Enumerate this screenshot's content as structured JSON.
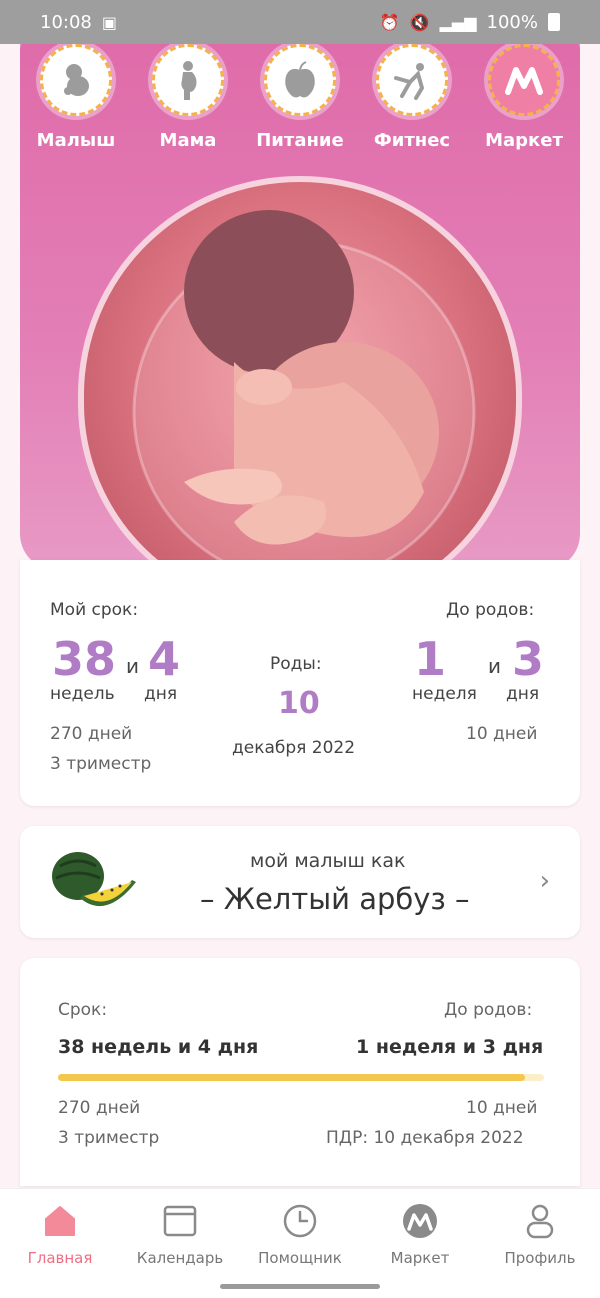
{
  "status_bar": {
    "time": "10:08",
    "battery": "100%"
  },
  "categories": [
    {
      "label": "Малыш",
      "icon": "baby-icon"
    },
    {
      "label": "Мама",
      "icon": "pregnant-mother-icon"
    },
    {
      "label": "Питание",
      "icon": "apple-icon"
    },
    {
      "label": "Фитнес",
      "icon": "yoga-icon"
    },
    {
      "label": "Маркет",
      "icon": "market-logo-icon"
    }
  ],
  "term_card": {
    "my_term_label": "Мой срок:",
    "weeks": "38",
    "and": "и",
    "days": "4",
    "weeks_unit": "недель",
    "days_unit": "дня",
    "total_days": "270 дней",
    "trimester": "3 триместр",
    "birth_label": "Роды:",
    "birth_day": "10",
    "birth_month_year": "декабря 2022",
    "until_label": "До родов:",
    "until_weeks": "1",
    "until_and": "и",
    "until_days": "3",
    "until_weeks_unit": "неделя",
    "until_days_unit": "дня",
    "until_total_days": "10 дней"
  },
  "fruit_card": {
    "subtitle": "мой малыш как",
    "fruit_name": "– Желтый арбуз –"
  },
  "progress_card": {
    "term_label": "Срок:",
    "until_label": "До родов:",
    "term_value": "38 недель и 4 дня",
    "until_value": "1 неделя и 3 дня",
    "progress_percent": 96,
    "days": "270 дней",
    "trimester": "3 триместр",
    "days_left": "10 дней",
    "due_date": "ПДР: 10 декабря 2022"
  },
  "bottom_nav": [
    {
      "label": "Главная",
      "icon": "home-icon",
      "active": true
    },
    {
      "label": "Календарь",
      "icon": "calendar-icon",
      "active": false
    },
    {
      "label": "Помощник",
      "icon": "clock-icon",
      "active": false
    },
    {
      "label": "Маркет",
      "icon": "market-icon",
      "active": false
    },
    {
      "label": "Профиль",
      "icon": "profile-icon",
      "active": false
    }
  ],
  "colors": {
    "accent_pink": "#df6aa9",
    "number_purple": "#b07cc6",
    "progress_yellow": "#f3c84d",
    "active_nav": "#ee6f84"
  }
}
